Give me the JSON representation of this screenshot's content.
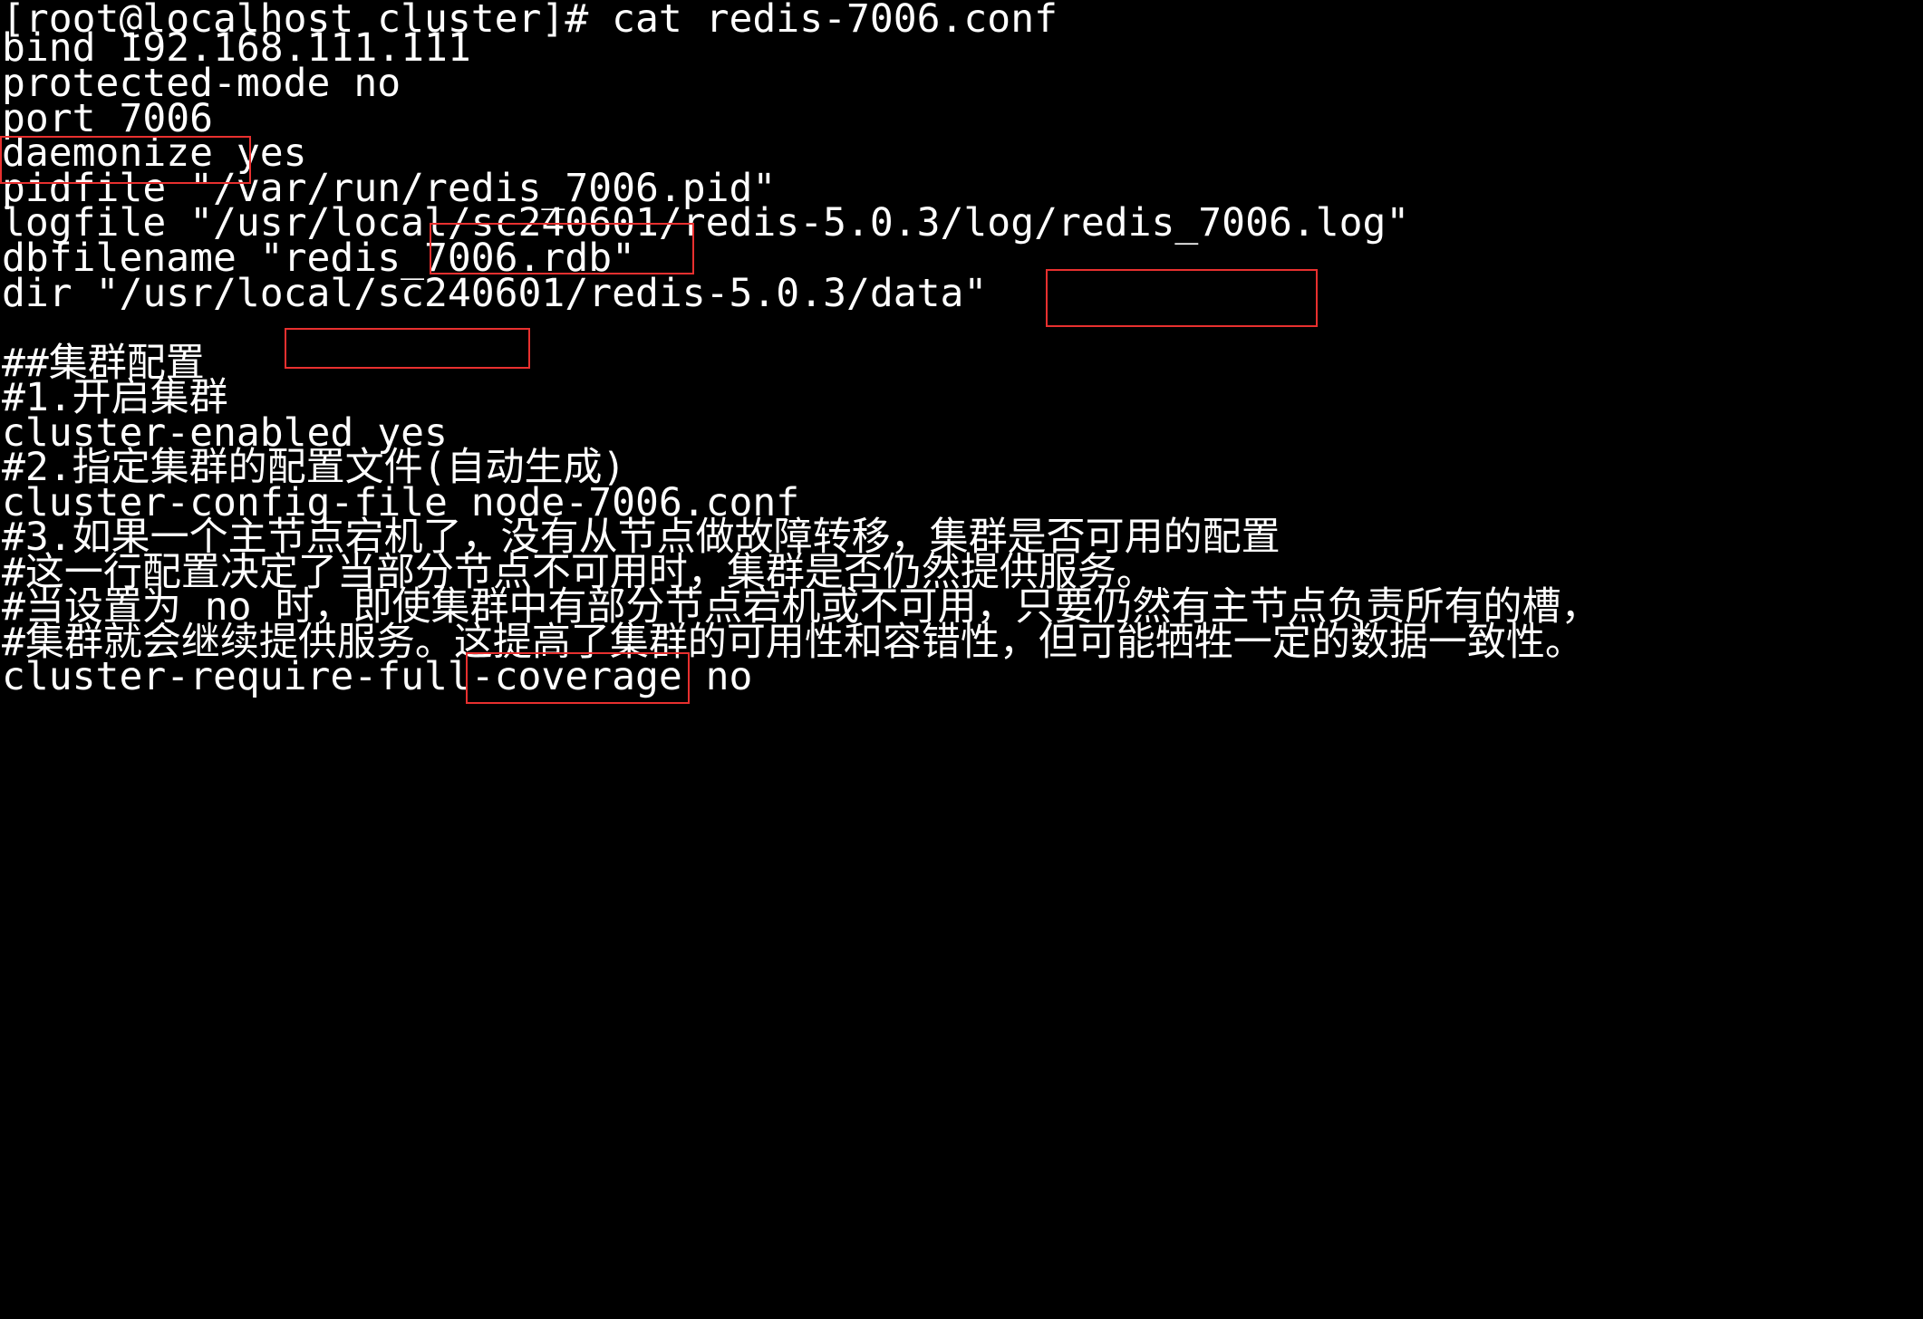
{
  "terminal": {
    "lines": [
      "[root@localhost cluster]# cat redis-7006.conf",
      "bind 192.168.111.111",
      "protected-mode no",
      "port 7006",
      "daemonize yes",
      "pidfile \"/var/run/redis_7006.pid\"",
      "logfile \"/usr/local/sc240601/redis-5.0.3/log/redis_7006.log\"",
      "dbfilename \"redis_7006.rdb\"",
      "dir \"/usr/local/sc240601/redis-5.0.3/data\"",
      "",
      "##集群配置",
      "#1.开启集群",
      "cluster-enabled yes",
      "#2.指定集群的配置文件(自动生成)",
      "cluster-config-file node-7006.conf",
      "#3.如果一个主节点宕机了，没有从节点做故障转移，集群是否可用的配置",
      "#这一行配置决定了当部分节点不可用时，集群是否仍然提供服务。",
      "#当设置为 no 时，即使集群中有部分节点宕机或不可用，只要仍然有主节点负责所有的槽，",
      "#集群就会继续提供服务。这提高了集群的可用性和容错性，但可能牺牲一定的数据一致性。",
      "cluster-require-full-coverage no"
    ],
    "highlights": [
      "port 7006",
      "redis_7006.",
      "redis_7006.",
      "redis_7006",
      "node-7006"
    ],
    "highlight_color": "#e8302f",
    "background": "#000000",
    "foreground": "#ffffff"
  }
}
